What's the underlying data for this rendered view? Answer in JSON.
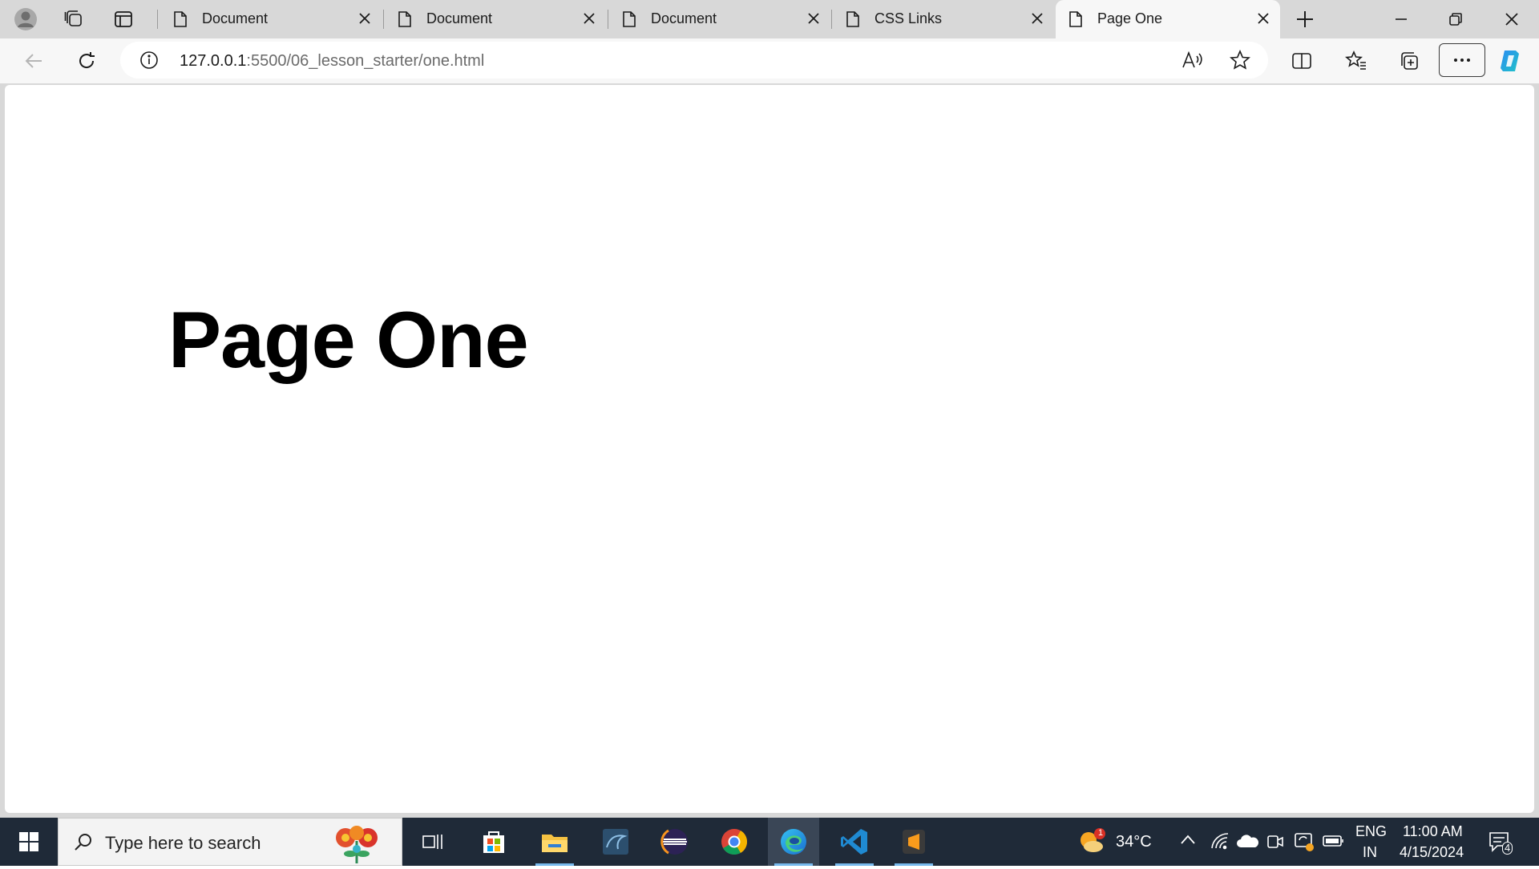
{
  "tabs": [
    {
      "title": "Document",
      "icon": "page-icon"
    },
    {
      "title": "Document",
      "icon": "page-icon"
    },
    {
      "title": "Document",
      "icon": "page-icon"
    },
    {
      "title": "CSS Links",
      "icon": "page-icon"
    },
    {
      "title": "Page One",
      "icon": "page-icon",
      "active": true
    }
  ],
  "address": {
    "host": "127.0.0.1",
    "path": ":5500/06_lesson_starter/one.html"
  },
  "page": {
    "heading": "Page One"
  },
  "taskbar": {
    "search_placeholder": "Type here to search",
    "weather_temp": "34°C",
    "weather_badge": "1",
    "language_line1": "ENG",
    "language_line2": "IN",
    "time": "11:00 AM",
    "date": "4/15/2024",
    "notification_count": "4"
  },
  "colors": {
    "tab_strip": "#d8d8d8",
    "toolbar": "#f7f7f7",
    "taskbar": "#1f2a38",
    "taskbar_active_underline": "#76b9ed"
  }
}
